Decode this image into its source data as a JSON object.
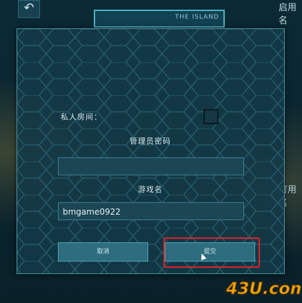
{
  "top": {
    "back_icon": "undo-arrow-icon",
    "map_text": "THE ISLAND",
    "right_label": "启用名"
  },
  "side_right_label": "可用名",
  "dialog": {
    "private_room_label": "私人房间：",
    "admin_password_label": "管理员密码",
    "admin_password_value": "",
    "game_name_label": "游戏名",
    "game_name_value": "bmgame0922",
    "cancel_label": "取消",
    "confirm_label": "提交"
  },
  "watermark": {
    "text": "43U.com"
  },
  "colors": {
    "highlight": "#e0222a",
    "accent": "#4ea1b4"
  }
}
